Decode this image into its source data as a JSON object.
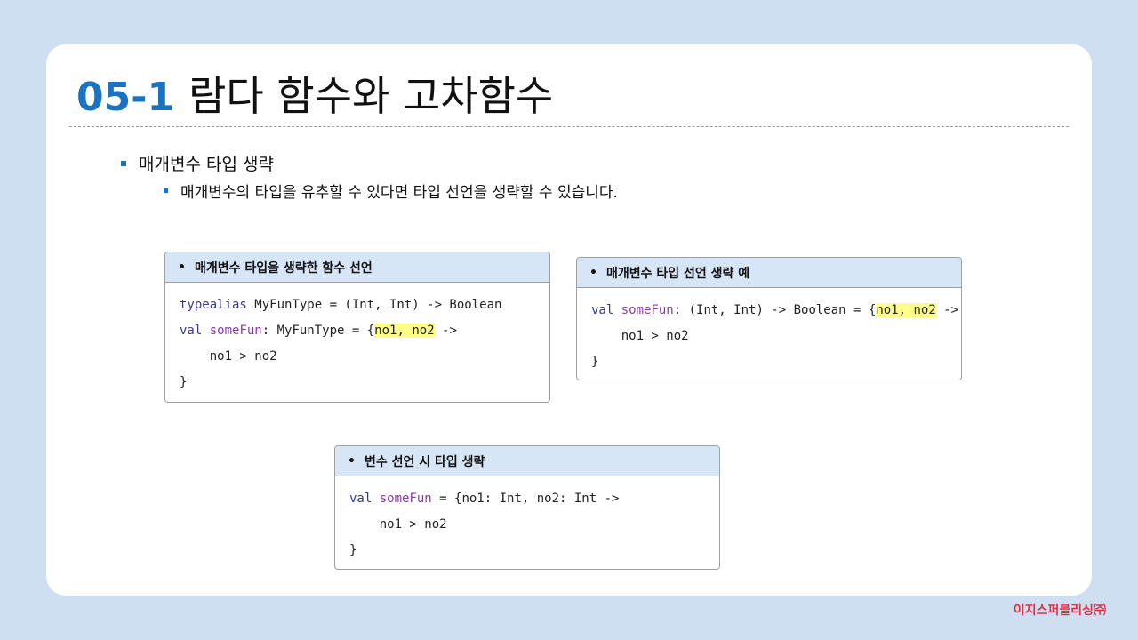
{
  "title": {
    "number": "05-1",
    "text": "람다 함수와 고차함수"
  },
  "bullets": {
    "level1": "매개변수 타입 생략",
    "level2": "매개변수의 타입을 유추할 수 있다면 타입 선언을 생략할 수 있습니다."
  },
  "boxes": {
    "box1": {
      "header": "매개변수 타입을 생략한 함수 선언",
      "line1": {
        "kw": "typealias",
        "rest": " MyFunType = (Int, Int) -> Boolean"
      },
      "line2": {
        "kw": "val",
        "fn": " someFun",
        "mid": ": MyFunType = {",
        "hl": "no1, no2",
        "end": " ->"
      },
      "line3": "    no1 > no2",
      "line4": "}"
    },
    "box2": {
      "header": "매개변수 타입 선언 생략 예",
      "line1": {
        "kw": "val",
        "fn": " someFun",
        "mid": ": (Int, Int) -> Boolean = {",
        "hl": "no1, no2",
        "end": " ->"
      },
      "line2": "    no1 > no2",
      "line3": "}"
    },
    "box3": {
      "header": "변수 선언 시 타입 생략",
      "line1": {
        "kw": "val",
        "fn": " someFun",
        "rest": " = {no1: Int, no2: Int ->"
      },
      "line2": "    no1 > no2",
      "line3": "}"
    },
    "bullet_glyph": "•"
  },
  "footer": "이지스퍼블리싱㈜",
  "colors": {
    "accent": "#1a73c0",
    "highlight": "#ffff88",
    "header_bg": "#d6e6f6",
    "footer": "#d9334a"
  }
}
